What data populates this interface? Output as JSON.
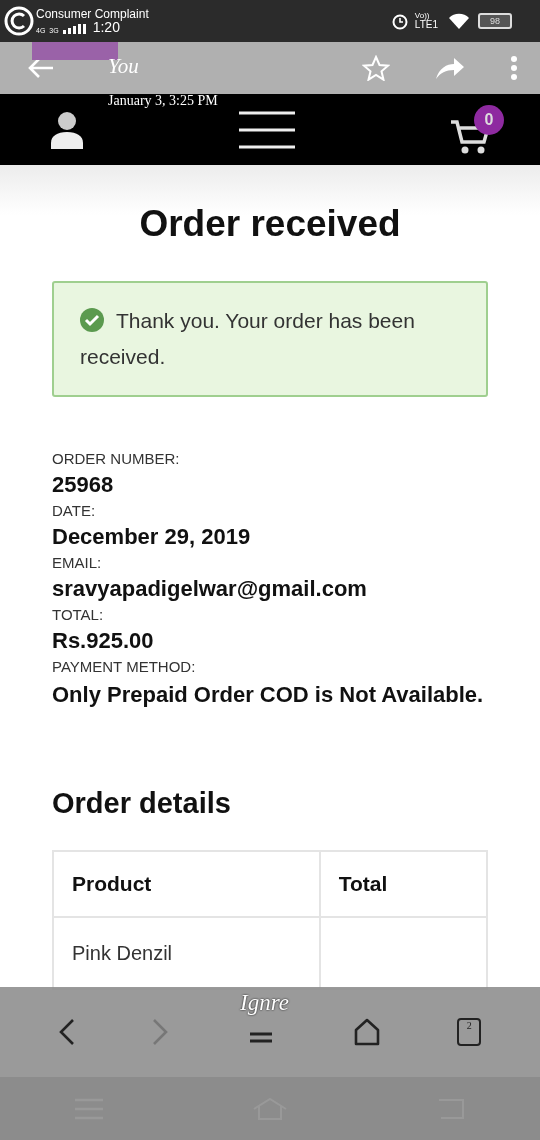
{
  "status_bar": {
    "app_label": "Consumer Complaint",
    "network_1": "4G",
    "network_2": "3G",
    "time": "1:20",
    "volte": "Vo))",
    "lte": "LTE1",
    "battery": "98"
  },
  "story_overlay": {
    "author": "You",
    "timestamp": "January 3, 3:25 PM"
  },
  "site_header": {
    "cart_count": "0"
  },
  "page": {
    "title": "Order received",
    "notice": "Thank you. Your order has been received.",
    "details": [
      {
        "label": "ORDER NUMBER:",
        "value": "25968"
      },
      {
        "label": "DATE:",
        "value": "December 29, 2019"
      },
      {
        "label": "EMAIL:",
        "value": "sravyapadigelwar@gmail.com"
      },
      {
        "label": "TOTAL:",
        "value": "Rs.925.00"
      },
      {
        "label": "PAYMENT METHOD:",
        "value": "Only Prepaid Order COD is Not Available."
      }
    ],
    "section_title": "Order details",
    "table": {
      "columns": [
        "Product",
        "Total"
      ],
      "rows": [
        {
          "product": "Pink Denzil"
        }
      ]
    }
  },
  "browser_toolbar": {
    "sticker_text": "Ignre",
    "tab_count": "2",
    "forward_disabled": true
  }
}
